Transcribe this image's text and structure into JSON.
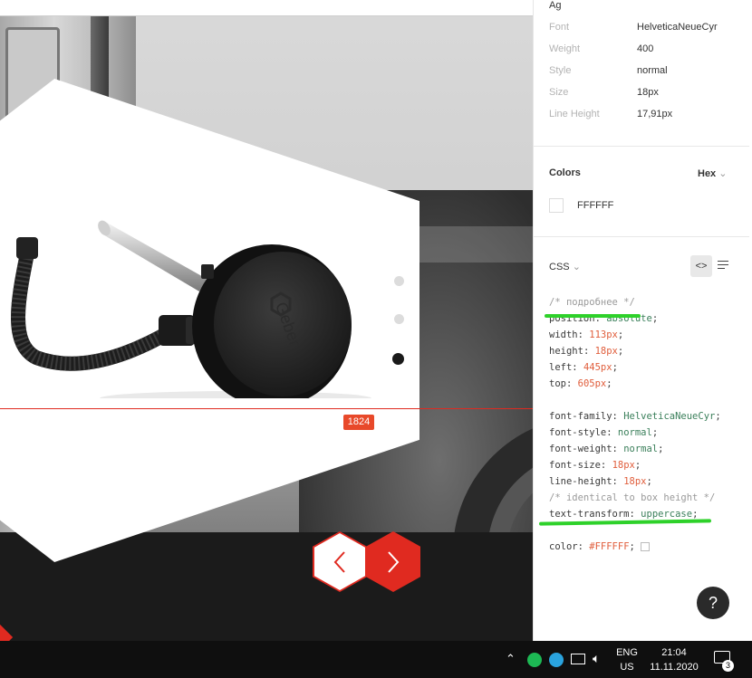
{
  "inspector": {
    "typography": {
      "sample": "Ag",
      "rows": [
        {
          "label": "Font",
          "value": "HelveticaNeueCyr"
        },
        {
          "label": "Weight",
          "value": "400"
        },
        {
          "label": "Style",
          "value": "normal"
        },
        {
          "label": "Size",
          "value": "18px"
        },
        {
          "label": "Line Height",
          "value": "17,91px"
        }
      ]
    },
    "colors": {
      "title": "Colors",
      "format": "Hex",
      "swatch_value": "FFFFFF"
    },
    "css": {
      "title": "CSS",
      "lines": [
        {
          "type": "comment",
          "text": "/* подробнее */"
        },
        {
          "prop": "position",
          "value": "absolute",
          "kind": "str"
        },
        {
          "prop": "width",
          "value": "113px",
          "kind": "num"
        },
        {
          "prop": "height",
          "value": "18px",
          "kind": "num"
        },
        {
          "prop": "left",
          "value": "445px",
          "kind": "num"
        },
        {
          "prop": "top",
          "value": "605px",
          "kind": "num"
        },
        {
          "type": "blank"
        },
        {
          "prop": "font-family",
          "value": "HelveticaNeueCyr",
          "kind": "str"
        },
        {
          "prop": "font-style",
          "value": "normal",
          "kind": "str"
        },
        {
          "prop": "font-weight",
          "value": "normal",
          "kind": "str"
        },
        {
          "prop": "font-size",
          "value": "18px",
          "kind": "num"
        },
        {
          "prop": "line-height",
          "value": "18px",
          "kind": "num"
        },
        {
          "type": "comment",
          "text": "/* identical to box height */"
        },
        {
          "prop": "text-transform",
          "value": "uppercase",
          "kind": "str"
        },
        {
          "type": "blank"
        },
        {
          "prop": "color",
          "value": "#FFFFFF",
          "kind": "num"
        }
      ]
    },
    "help_label": "?"
  },
  "canvas": {
    "badge": "1824",
    "prev_arrow": "‹",
    "next_arrow": "›",
    "carousel_active_index": 2,
    "carousel_count": 3,
    "accent_color": "#e02a20"
  },
  "taskbar": {
    "lang_top": "ENG",
    "lang_bottom": "US",
    "time": "21:04",
    "date": "11.11.2020",
    "notifications": "3",
    "tray_icons": [
      "chevron-up-icon",
      "spotify-icon",
      "telegram-icon",
      "network-icon",
      "volume-icon"
    ]
  }
}
